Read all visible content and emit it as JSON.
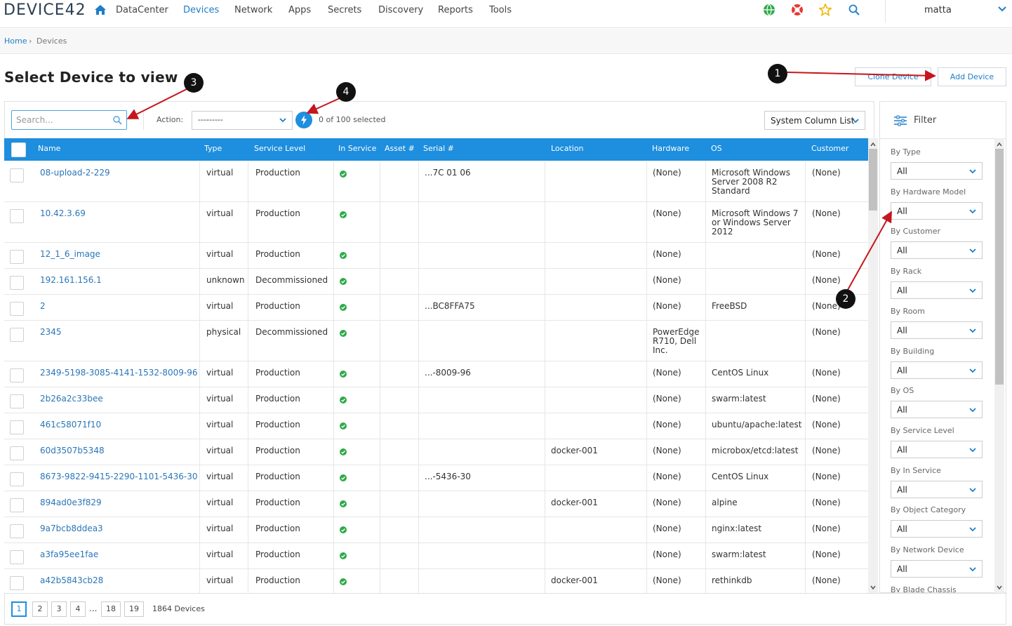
{
  "app": {
    "logo": "DEVICE42"
  },
  "nav": {
    "items": [
      "DataCenter",
      "Devices",
      "Network",
      "Apps",
      "Secrets",
      "Discovery",
      "Reports",
      "Tools"
    ],
    "active": "Devices",
    "user": "matta",
    "icons": [
      "home-icon",
      "globe-icon",
      "lifebuoy-icon",
      "star-icon",
      "search-icon"
    ]
  },
  "breadcrumb": {
    "home": "Home",
    "sep": "›",
    "current": "Devices"
  },
  "page": {
    "title": "Select Device to view",
    "clone_label": "Clone Device",
    "add_label": "Add Device"
  },
  "toolbar": {
    "search_placeholder": "Search...",
    "action_label": "Action:",
    "action_value": "---------",
    "selected_text": "0 of 100 selected",
    "column_list": "System Column List",
    "filter_label": "Filter"
  },
  "table": {
    "columns": [
      "Name",
      "Type",
      "Service Level",
      "In Service",
      "Asset #",
      "Serial #",
      "Location",
      "Hardware",
      "OS",
      "Customer"
    ],
    "rows": [
      {
        "name": "08-upload-2-229",
        "type": "virtual",
        "service": "Production",
        "serial": "...7C 01 06",
        "location": "",
        "hardware": "(None)",
        "os": "Microsoft Windows Server 2008 R2 Standard",
        "customer": "(None)"
      },
      {
        "name": "10.42.3.69",
        "type": "virtual",
        "service": "Production",
        "serial": "",
        "location": "",
        "hardware": "(None)",
        "os": "Microsoft Windows 7 or Windows Server 2012",
        "customer": "(None)"
      },
      {
        "name": "12_1_6_image",
        "type": "virtual",
        "service": "Production",
        "serial": "",
        "location": "",
        "hardware": "(None)",
        "os": "",
        "customer": "(None)"
      },
      {
        "name": "192.161.156.1",
        "type": "unknown",
        "service": "Decommissioned",
        "serial": "",
        "location": "",
        "hardware": "(None)",
        "os": "",
        "customer": "(None)"
      },
      {
        "name": "2",
        "type": "virtual",
        "service": "Production",
        "serial": "...BC8FFA75",
        "location": "",
        "hardware": "(None)",
        "os": "FreeBSD",
        "customer": "(None)"
      },
      {
        "name": "2345",
        "type": "physical",
        "service": "Decommissioned",
        "serial": "",
        "location": "",
        "hardware": "PowerEdge R710, Dell Inc.",
        "os": "",
        "customer": "(None)"
      },
      {
        "name": "2349-5198-3085-4141-1532-8009-96",
        "type": "virtual",
        "service": "Production",
        "serial": "...-8009-96",
        "location": "",
        "hardware": "(None)",
        "os": "CentOS Linux",
        "customer": "(None)"
      },
      {
        "name": "2b26a2c33bee",
        "type": "virtual",
        "service": "Production",
        "serial": "",
        "location": "",
        "hardware": "(None)",
        "os": "swarm:latest",
        "customer": "(None)"
      },
      {
        "name": "461c58071f10",
        "type": "virtual",
        "service": "Production",
        "serial": "",
        "location": "",
        "hardware": "(None)",
        "os": "ubuntu/apache:latest",
        "customer": "(None)"
      },
      {
        "name": "60d3507b5348",
        "type": "virtual",
        "service": "Production",
        "serial": "",
        "location": "docker-001",
        "hardware": "(None)",
        "os": "microbox/etcd:latest",
        "customer": "(None)"
      },
      {
        "name": "8673-9822-9415-2290-1101-5436-30",
        "type": "virtual",
        "service": "Production",
        "serial": "...-5436-30",
        "location": "",
        "hardware": "(None)",
        "os": "CentOS Linux",
        "customer": "(None)"
      },
      {
        "name": "894ad0e3f829",
        "type": "virtual",
        "service": "Production",
        "serial": "",
        "location": "docker-001",
        "hardware": "(None)",
        "os": "alpine",
        "customer": "(None)"
      },
      {
        "name": "9a7bcb8ddea3",
        "type": "virtual",
        "service": "Production",
        "serial": "",
        "location": "",
        "hardware": "(None)",
        "os": "nginx:latest",
        "customer": "(None)"
      },
      {
        "name": "a3fa95ee1fae",
        "type": "virtual",
        "service": "Production",
        "serial": "",
        "location": "",
        "hardware": "(None)",
        "os": "swarm:latest",
        "customer": "(None)"
      },
      {
        "name": "a42b5843cb28",
        "type": "virtual",
        "service": "Production",
        "serial": "",
        "location": "docker-001",
        "hardware": "(None)",
        "os": "rethinkdb",
        "customer": "(None)"
      }
    ]
  },
  "filters": [
    {
      "label": "By Type",
      "value": "All"
    },
    {
      "label": "By Hardware Model",
      "value": "All"
    },
    {
      "label": "By Customer",
      "value": "All"
    },
    {
      "label": "By Rack",
      "value": "All"
    },
    {
      "label": "By Room",
      "value": "All"
    },
    {
      "label": "By Building",
      "value": "All"
    },
    {
      "label": "By OS",
      "value": "All"
    },
    {
      "label": "By Service Level",
      "value": "All"
    },
    {
      "label": "By In Service",
      "value": "All"
    },
    {
      "label": "By Object Category",
      "value": "All"
    },
    {
      "label": "By Network Device",
      "value": "All"
    },
    {
      "label": "By Blade Chassis",
      "value": "All"
    }
  ],
  "pagination": {
    "pages": [
      "1",
      "2",
      "3",
      "4",
      "18",
      "19"
    ],
    "ellipsis": "...",
    "current": "1",
    "total_text": "1864 Devices"
  },
  "annotations": [
    "1",
    "2",
    "3",
    "4"
  ],
  "colors": {
    "accent": "#1e8ede",
    "link": "#2a76b8",
    "ok": "#2eaa4a",
    "callout": "#111111",
    "arrow": "#c4161c"
  }
}
